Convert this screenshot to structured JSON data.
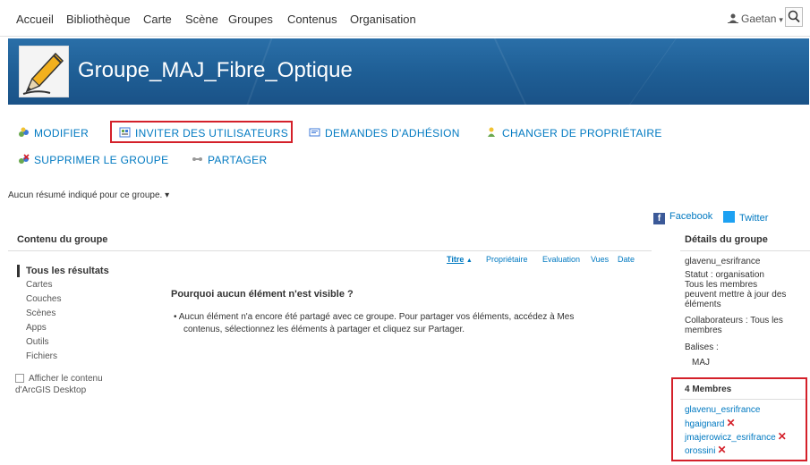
{
  "nav": {
    "items": [
      "Accueil",
      "Bibliothèque",
      "Carte",
      "Scène",
      "Groupes",
      "Contenus",
      "Organisation"
    ],
    "user": "Gaetan",
    "user_icon": "user-icon",
    "search_icon": "search-icon"
  },
  "banner": {
    "title": "Groupe_MAJ_Fibre_Optique",
    "thumb_icon": "pencil-icon"
  },
  "actions": {
    "modify": "MODIFIER",
    "invite": "INVITER DES UTILISATEURS",
    "requests": "DEMANDES D'ADHÉSION",
    "change_owner": "CHANGER DE PROPRIÉTAIRE",
    "delete": "SUPPRIMER LE GROUPE",
    "share": "PARTAGER"
  },
  "summary": "Aucun résumé indiqué pour ce groupe. ▾",
  "social": {
    "facebook": "Facebook",
    "twitter": "Twitter"
  },
  "content": {
    "title": "Contenu du groupe",
    "filters": [
      "Tous les résultats",
      "Cartes",
      "Couches",
      "Scènes",
      "Apps",
      "Outils",
      "Fichiers"
    ],
    "desktop_checkbox_line1": "Afficher le contenu",
    "desktop_checkbox_line2": "d'ArcGIS Desktop",
    "sort": {
      "title": "Titre",
      "title_arrow": "▲",
      "owner": "Propriétaire",
      "rating": "Evaluation",
      "views": "Vues",
      "date": "Date"
    },
    "empty_title": "Pourquoi aucun élément n'est visible ?",
    "empty_line1": "• Aucun élément n'a encore été partagé avec ce groupe. Pour partager vos éléments, accédez à Mes",
    "empty_line2": "contenus, sélectionnez les éléments à partager et cliquez sur Partager."
  },
  "details": {
    "title": "Détails du groupe",
    "owner": "glavenu_esrifrance",
    "status_lines": [
      "Statut : organisation",
      "Tous les membres",
      "peuvent mettre à jour des",
      "éléments"
    ],
    "collab_lines": [
      "Collaborateurs : Tous les",
      "membres"
    ],
    "tags_label": "Balises :",
    "tag": "MAJ",
    "members_title": "4 Membres",
    "members": [
      {
        "name": "glavenu_esrifrance",
        "removable": false
      },
      {
        "name": "hgaignard",
        "removable": true
      },
      {
        "name": "jmajerowicz_esrifrance",
        "removable": true
      },
      {
        "name": "orossini",
        "removable": true
      }
    ],
    "remove_glyph": "✕"
  },
  "colors": {
    "link": "#0079c1",
    "highlight": "#d4202a",
    "banner": "#1f5f96"
  }
}
